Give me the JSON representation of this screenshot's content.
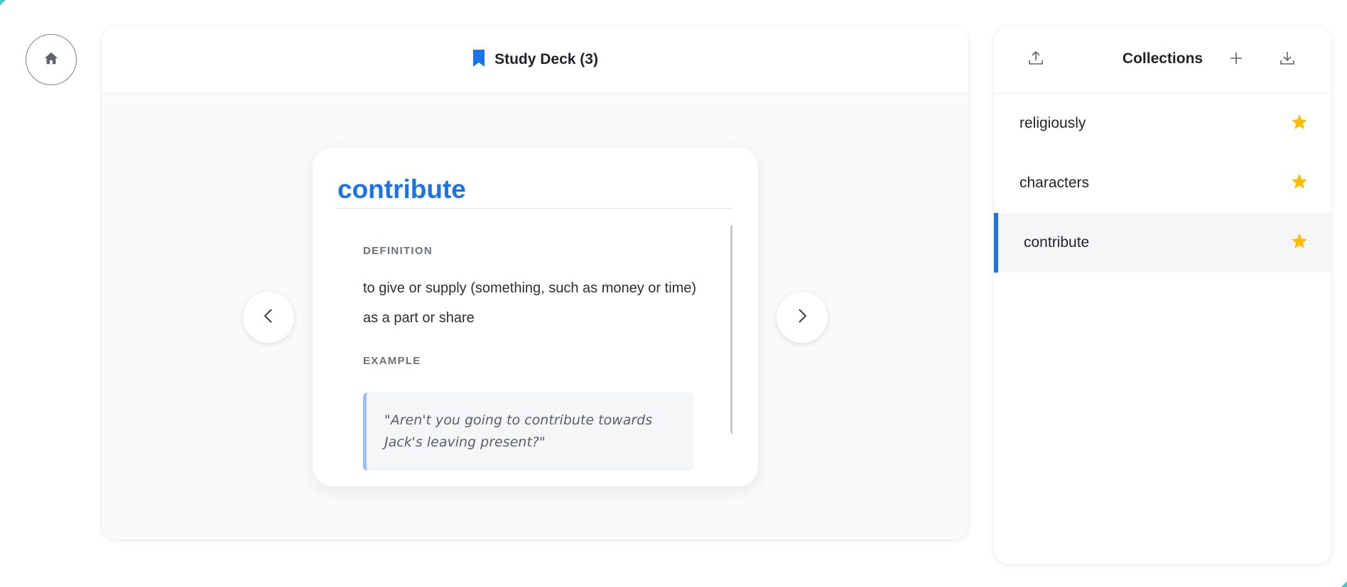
{
  "main": {
    "deck_title": "Study Deck (3)",
    "card": {
      "word": "contribute",
      "definition_label": "DEFINITION",
      "definition": "to give or supply (something, such as money or time) as a part or share",
      "example_label": "EXAMPLE",
      "example": "\"Aren't you going to contribute towards Jack's leaving present?\""
    }
  },
  "collections": {
    "title": "Collections",
    "items": [
      {
        "label": "religiously",
        "starred": true
      },
      {
        "label": "characters",
        "starred": true
      },
      {
        "label": "contribute",
        "starred": true,
        "active": true
      }
    ]
  },
  "colors": {
    "accent": "#1a73e8",
    "star": "#fbbc04",
    "corner": "#49c6c0"
  },
  "icons": {
    "home": "home-icon",
    "deck": "bookmark-icon",
    "prev": "chevron-left-icon",
    "next": "chevron-right-icon",
    "upload": "upload-icon",
    "add": "plus-icon",
    "download": "download-icon",
    "star": "star-icon"
  }
}
